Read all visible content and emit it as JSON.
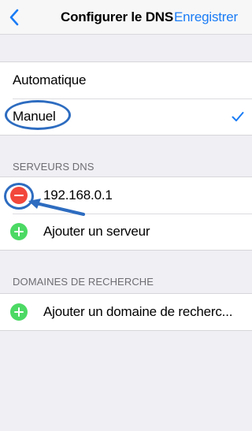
{
  "navbar": {
    "title": "Configurer le DNS",
    "save_label": "Enregistrer"
  },
  "mode": {
    "options": [
      {
        "label": "Automatique",
        "selected": false
      },
      {
        "label": "Manuel",
        "selected": true
      }
    ]
  },
  "dns_servers": {
    "header": "SERVEURS DNS",
    "servers": [
      "192.168.0.1"
    ],
    "add_label": "Ajouter un serveur"
  },
  "search_domains": {
    "header": "DOMAINES DE RECHERCHE",
    "add_label": "Ajouter un domaine de recherc..."
  },
  "colors": {
    "accent": "#1a7cf5",
    "delete": "#f2473b",
    "add": "#4cd964",
    "annotation": "#2d6cc0"
  }
}
